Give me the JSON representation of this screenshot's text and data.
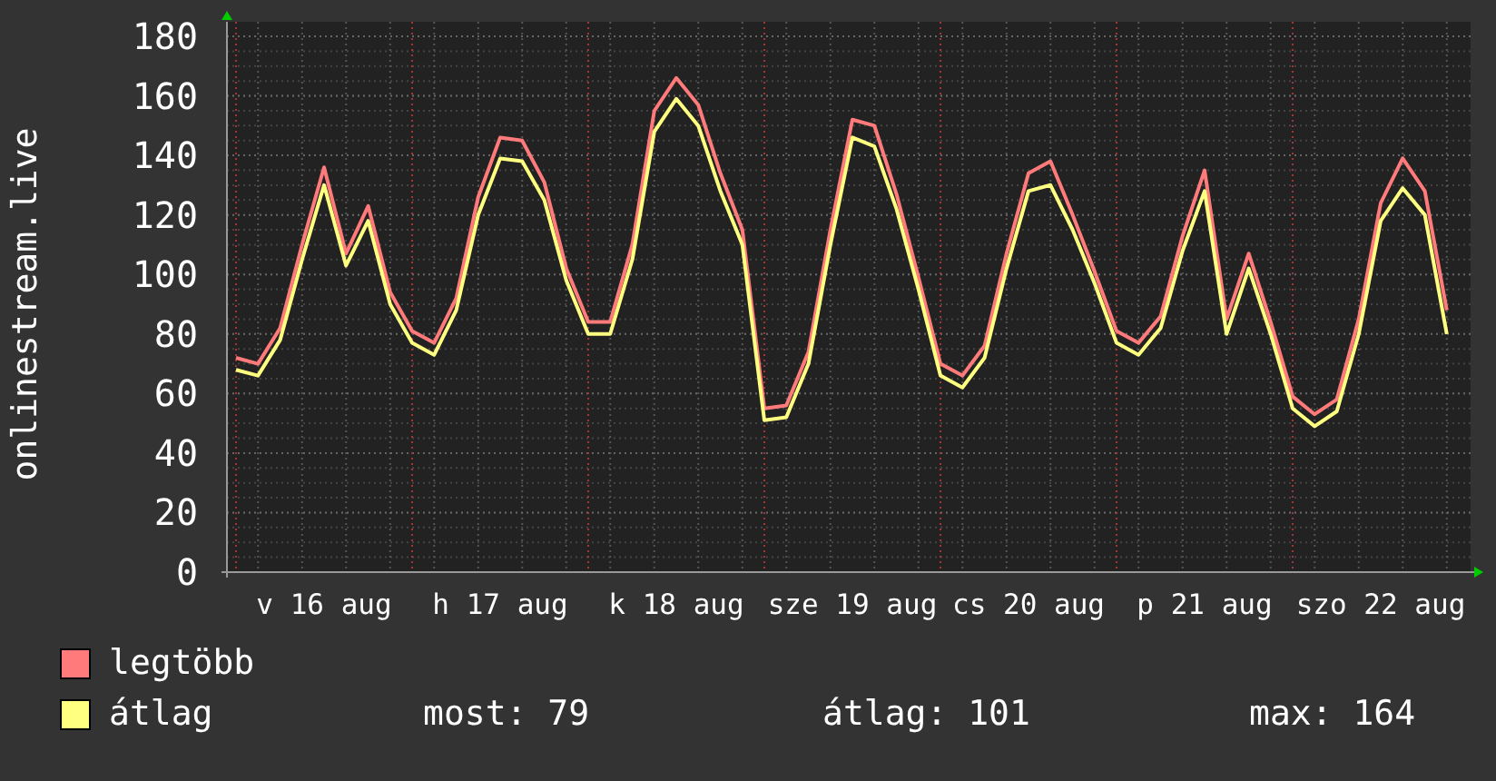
{
  "chart_data": {
    "type": "line",
    "grid": true,
    "ylabel": "onlinestream.live",
    "ylim": [
      0,
      180
    ],
    "yticks": [
      0,
      20,
      40,
      60,
      80,
      100,
      120,
      140,
      160,
      180
    ],
    "categories": [
      null,
      null,
      null,
      null,
      "v 16 aug",
      null,
      null,
      null,
      null,
      null,
      null,
      null,
      "h 17 aug",
      null,
      null,
      null,
      null,
      null,
      null,
      null,
      "k 18 aug",
      null,
      null,
      null,
      null,
      null,
      null,
      null,
      "sze 19 aug",
      null,
      null,
      null,
      null,
      null,
      null,
      null,
      "cs 20 aug",
      null,
      null,
      null,
      null,
      null,
      null,
      null,
      "p 21 aug",
      null,
      null,
      null,
      null,
      null,
      null,
      null,
      "szo 22 aug",
      null,
      null,
      null
    ],
    "series": [
      {
        "name": "legtöbb",
        "color": "#ff7a7a",
        "values": [
          72,
          70,
          82,
          110,
          136,
          107,
          123,
          94,
          81,
          77,
          92,
          126,
          146,
          145,
          131,
          102,
          84,
          84,
          110,
          155,
          166,
          157,
          134,
          115,
          55,
          56,
          74,
          115,
          152,
          150,
          127,
          99,
          70,
          66,
          76,
          107,
          134,
          138,
          120,
          101,
          81,
          77,
          86,
          113,
          135,
          85,
          107,
          84,
          59,
          53,
          58,
          85,
          124,
          139,
          128,
          88
        ]
      },
      {
        "name": "átlag",
        "color": "#ffff80",
        "values": [
          68,
          66,
          78,
          105,
          130,
          103,
          118,
          90,
          77,
          73,
          88,
          120,
          139,
          138,
          125,
          98,
          80,
          80,
          105,
          148,
          159,
          150,
          128,
          110,
          51,
          52,
          70,
          110,
          146,
          143,
          122,
          95,
          66,
          62,
          72,
          102,
          128,
          130,
          115,
          97,
          77,
          73,
          82,
          108,
          128,
          80,
          102,
          80,
          55,
          49,
          54,
          80,
          118,
          129,
          120,
          80
        ]
      }
    ]
  },
  "stats": [
    "most: 79",
    "átlag: 101",
    "max: 164"
  ]
}
